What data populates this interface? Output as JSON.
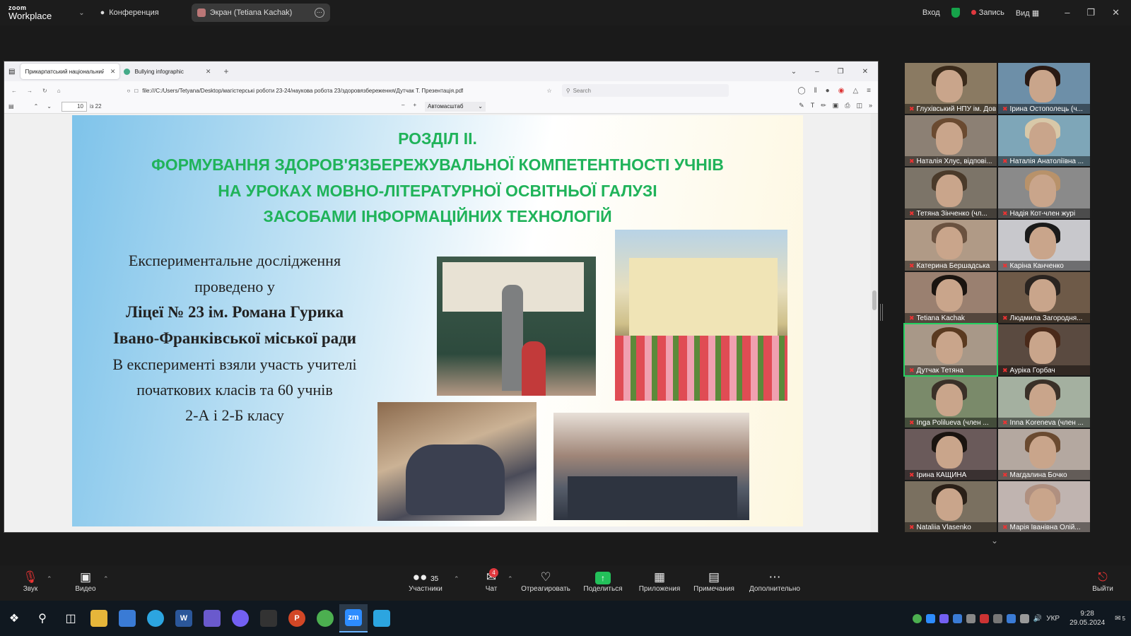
{
  "zoom_top": {
    "logo_small": "zoom",
    "logo_main": "Workplace",
    "conference_label": "Конференция",
    "share_label": "Экран (Tetiana Kachak)",
    "signin": "Вход",
    "record": "Запись",
    "view": "Вид"
  },
  "browser": {
    "tab1": "Прикарпатський національний ун",
    "tab2": "Bullying infographic",
    "url": "file:///C:/Users/Tetyana/Desktop/магістерські роботи 23-24/наукова робота 23/здоровязбереження/Дутчак Т. Презентація.pdf",
    "search_placeholder": "Search",
    "page_current": "10",
    "page_total": "із 22",
    "zoom_mode": "Автомасштаб"
  },
  "slide": {
    "title1": "РОЗДІЛ ІІ.",
    "title2": "ФОРМУВАННЯ ЗДОРОВ'ЯЗБЕРЕЖУВАЛЬНОЇ КОМПЕТЕНТНОСТІ УЧНІВ",
    "title3": "НА УРОКАХ МОВНО-ЛІТЕРАТУРНОЇ ОСВІТНЬОЇ ГАЛУЗІ",
    "title4": "ЗАСОБАМИ ІНФОРМАЦІЙНИХ ТЕХНОЛОГІЙ",
    "line1": "Експериментальне дослідження",
    "line2": "проведено у",
    "line3": "Ліцеї № 23 ім. Романа Гурика",
    "line4": "Івано-Франківської міської ради",
    "line5": "В експерименті взяли участь учителі",
    "line6": "початкових класів та 60 учнів",
    "line7": "2-А і  2-Б класу"
  },
  "participants": [
    {
      "name": "Глухівський НПУ ім. Дов..."
    },
    {
      "name": "Ірина Остополець (ч..."
    },
    {
      "name": "Наталія Хлус, відпові..."
    },
    {
      "name": "Наталія Анатоліївна ..."
    },
    {
      "name": "Тетяна Зінченко (чл..."
    },
    {
      "name": "Надія Кот-член журі"
    },
    {
      "name": "Катерина Бершадська"
    },
    {
      "name": "Каріна Канченко"
    },
    {
      "name": "Tetiana Kachak"
    },
    {
      "name": "Людмила Загородня..."
    },
    {
      "name": "Дутчак Тетяна"
    },
    {
      "name": "Ауріка Горбач"
    },
    {
      "name": "Inga Polilueva (член ..."
    },
    {
      "name": "Inna Koreneva (член ..."
    },
    {
      "name": "Ірина КАЩИНА"
    },
    {
      "name": "Магдалина Бочко"
    },
    {
      "name": "Nataliia Vlasenko"
    },
    {
      "name": "Марія Іванівна Олій..."
    }
  ],
  "zoom_bottom": {
    "audio": "Звук",
    "video": "Видео",
    "participants_count": "35",
    "participants": "Участники",
    "chat_badge": "4",
    "chat": "Чат",
    "react": "Отреагировать",
    "share": "Поделиться",
    "apps": "Приложения",
    "notes": "Примечания",
    "more": "Дополнительно",
    "leave": "Выйти"
  },
  "taskbar": {
    "lang": "УКР",
    "time": "9:28",
    "date": "29.05.2024",
    "notif_count": "5"
  }
}
